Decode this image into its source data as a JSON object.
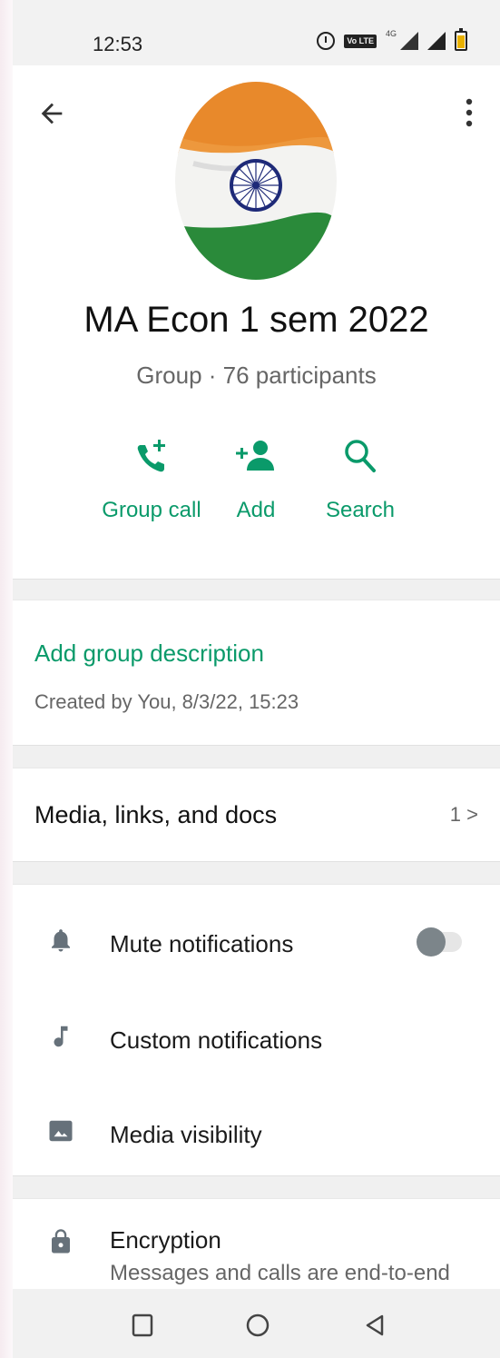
{
  "status_bar": {
    "time": "12:53",
    "volte_label": "Vo LTE",
    "network_label": "4G"
  },
  "header": {
    "back_icon": "arrow-back-icon",
    "more_icon": "more-vertical-icon"
  },
  "profile": {
    "name": "MA Econ 1 sem 2022",
    "meta": "Group · 76 participants"
  },
  "actions": [
    {
      "label": "Group call",
      "icon": "add-call-icon"
    },
    {
      "label": "Add",
      "icon": "add-person-icon"
    },
    {
      "label": "Search",
      "icon": "search-icon"
    }
  ],
  "description": {
    "link": "Add group description",
    "created": "Created by You, 8/3/22, 15:23"
  },
  "media": {
    "label": "Media, links, and docs",
    "count": "1",
    "chevron": ">"
  },
  "settings": [
    {
      "label": "Mute notifications",
      "icon": "bell-icon",
      "toggle": false
    },
    {
      "label": "Custom notifications",
      "icon": "music-note-icon"
    },
    {
      "label": "Media visibility",
      "icon": "image-icon"
    }
  ],
  "encryption": {
    "label": "Encryption",
    "sub": "Messages and calls are end-to-end",
    "icon": "lock-icon"
  },
  "colors": {
    "accent": "#0a9a6a",
    "saffron": "#e8892b",
    "green": "#2a8a3a",
    "chakra": "#1e2a78"
  }
}
